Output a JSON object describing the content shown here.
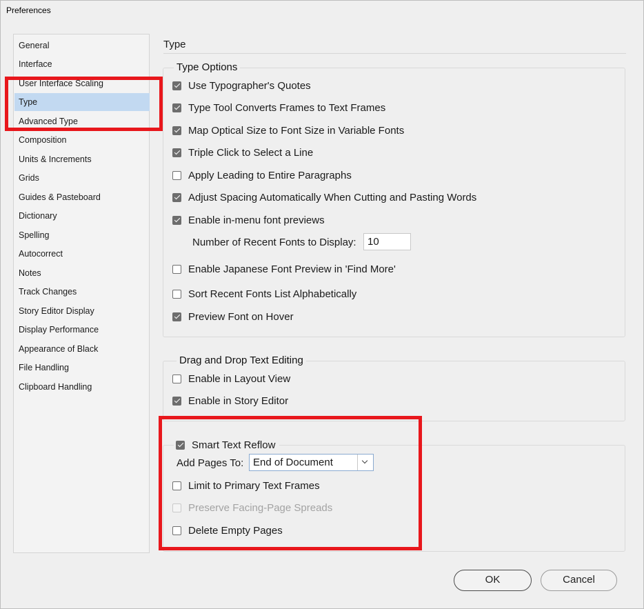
{
  "window": {
    "title": "Preferences"
  },
  "sidebar": {
    "items": [
      {
        "label": "General",
        "selected": false
      },
      {
        "label": "Interface",
        "selected": false
      },
      {
        "label": "User Interface Scaling",
        "selected": false
      },
      {
        "label": "Type",
        "selected": true
      },
      {
        "label": "Advanced Type",
        "selected": false
      },
      {
        "label": "Composition",
        "selected": false
      },
      {
        "label": "Units & Increments",
        "selected": false
      },
      {
        "label": "Grids",
        "selected": false
      },
      {
        "label": "Guides & Pasteboard",
        "selected": false
      },
      {
        "label": "Dictionary",
        "selected": false
      },
      {
        "label": "Spelling",
        "selected": false
      },
      {
        "label": "Autocorrect",
        "selected": false
      },
      {
        "label": "Notes",
        "selected": false
      },
      {
        "label": "Track Changes",
        "selected": false
      },
      {
        "label": "Story Editor Display",
        "selected": false
      },
      {
        "label": "Display Performance",
        "selected": false
      },
      {
        "label": "Appearance of Black",
        "selected": false
      },
      {
        "label": "File Handling",
        "selected": false
      },
      {
        "label": "Clipboard Handling",
        "selected": false
      }
    ]
  },
  "section": {
    "title": "Type"
  },
  "type_options": {
    "legend": "Type Options",
    "options": [
      {
        "label": "Use Typographer's Quotes",
        "checked": true
      },
      {
        "label": "Type Tool Converts Frames to Text Frames",
        "checked": true
      },
      {
        "label": "Map Optical Size to Font Size in Variable Fonts",
        "checked": true
      },
      {
        "label": "Triple Click to Select a Line",
        "checked": true
      },
      {
        "label": "Apply Leading to Entire Paragraphs",
        "checked": false
      },
      {
        "label": "Adjust Spacing Automatically When Cutting and Pasting Words",
        "checked": true
      },
      {
        "label": "Enable in-menu font previews",
        "checked": true
      },
      {
        "label": "Enable Japanese Font Preview in 'Find More'",
        "checked": false
      },
      {
        "label": "Sort Recent Fonts List Alphabetically",
        "checked": false
      },
      {
        "label": "Preview Font on Hover",
        "checked": true
      }
    ],
    "recent_fonts_label": "Number of Recent Fonts to Display:",
    "recent_fonts_value": "10"
  },
  "drag_drop": {
    "legend": "Drag and Drop Text Editing",
    "options": [
      {
        "label": "Enable in Layout View",
        "checked": false
      },
      {
        "label": "Enable in Story Editor",
        "checked": true
      }
    ]
  },
  "smart_reflow": {
    "label": "Smart Text Reflow",
    "checked": true,
    "add_pages_label": "Add Pages To:",
    "add_pages_value": "End of Document",
    "options": [
      {
        "label": "Limit to Primary Text Frames",
        "checked": false,
        "disabled": false
      },
      {
        "label": "Preserve Facing-Page Spreads",
        "checked": false,
        "disabled": true
      },
      {
        "label": "Delete Empty Pages",
        "checked": false,
        "disabled": false
      }
    ]
  },
  "buttons": {
    "ok": "OK",
    "cancel": "Cancel"
  },
  "colors": {
    "highlight": "#e8171c",
    "selection": "#c2d9f1"
  }
}
